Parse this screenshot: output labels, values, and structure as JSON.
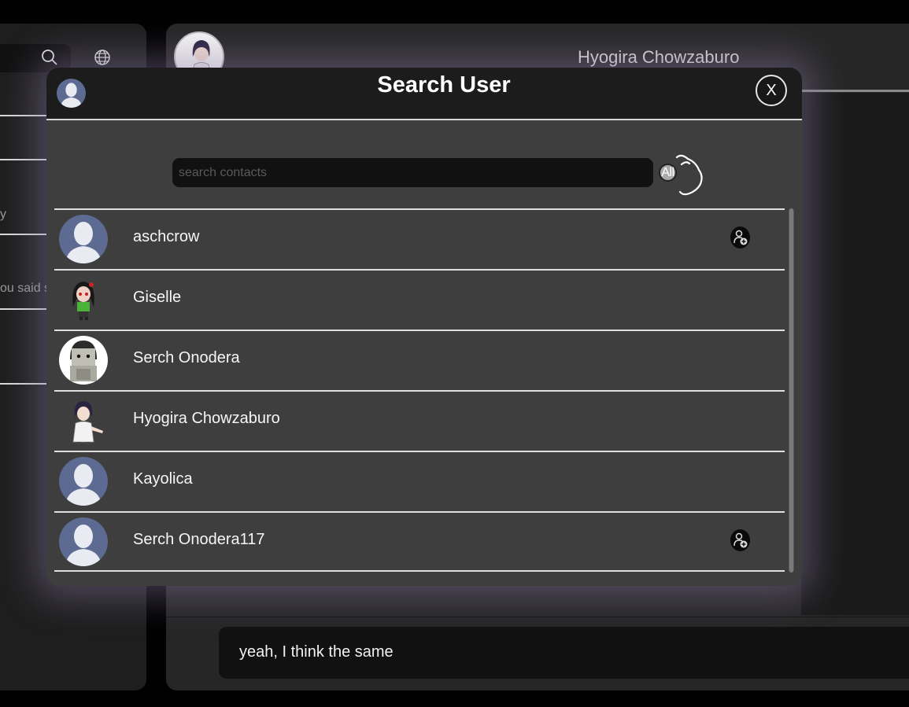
{
  "background": {
    "left_snippets": [
      "y",
      "ou said s"
    ],
    "chat_header_name": "Hyogira Chowzaburo",
    "message_text": "yeah, I think the same"
  },
  "modal": {
    "title": "Search User",
    "close_label": "X",
    "search_placeholder": "search contacts",
    "filter_label": "All",
    "users": [
      {
        "name": "aschcrow",
        "avatar": "default-avatar",
        "has_add_button": true
      },
      {
        "name": "Giselle",
        "avatar": "anime-girl-avatar",
        "has_add_button": false
      },
      {
        "name": "Serch Onodera",
        "avatar": "gray-character-avatar",
        "has_add_button": false
      },
      {
        "name": "Hyogira Chowzaburo",
        "avatar": "anime-boy-avatar",
        "has_add_button": false
      },
      {
        "name": "Kayolica",
        "avatar": "default-avatar",
        "has_add_button": false
      },
      {
        "name": "Serch Onodera117",
        "avatar": "default-avatar",
        "has_add_button": true
      }
    ]
  },
  "colors": {
    "modal_bg": "#3e3e3e",
    "header_bg": "#1c1c1c",
    "default_avatar_bg": "#5d6a92",
    "glow": "#8778a5"
  }
}
